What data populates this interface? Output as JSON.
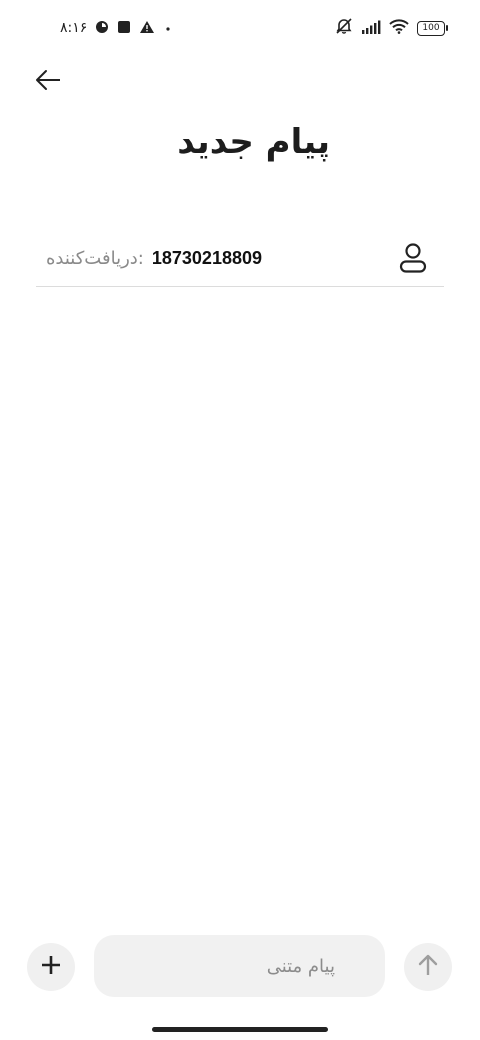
{
  "status_bar": {
    "time": "۸:۱۶",
    "battery": "100",
    "icons": [
      "data-saver-icon",
      "stop-square-icon",
      "warning-icon",
      "dot-icon",
      "muted-bell-icon",
      "signal-icon",
      "wifi-icon",
      "battery-icon"
    ]
  },
  "header": {
    "back_icon": "arrow-left-icon",
    "title": "پیام جدید"
  },
  "recipient": {
    "label": "دریافت‌کننده:",
    "value": "18730218809",
    "icon": "person-icon"
  },
  "composer": {
    "placeholder": "پیام متنی",
    "add_icon": "plus-icon",
    "send_icon": "arrow-up-icon"
  },
  "colors": {
    "background": "#ffffff",
    "text": "#222222",
    "muted": "#8a8a8a",
    "field_bg": "#f1f1f1"
  }
}
